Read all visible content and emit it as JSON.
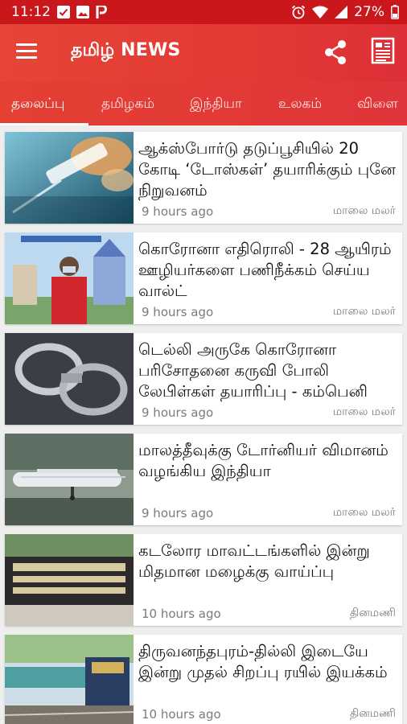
{
  "status_bar": {
    "time": "11:12",
    "battery": "27%"
  },
  "app_bar": {
    "title": "தமிழ் NEWS"
  },
  "tabs": [
    {
      "label": "தலைப்பு"
    },
    {
      "label": "தமிழகம்"
    },
    {
      "label": "இந்தியா"
    },
    {
      "label": "உலகம்"
    },
    {
      "label": "விளை"
    }
  ],
  "articles": [
    {
      "headline": "ஆக்ஸ்போர்டு தடுப்பூசியில் 20 கோடி ‘டோஸ்கள்’ தயாரிக்கும் புனே நிறுவனம்",
      "time": "9 hours ago",
      "source": "மாலை மலர்"
    },
    {
      "headline": "கொரோனா எதிரொலி - 28 ஆயிரம் ஊழியர்களை பணிநீக்கம் செய்ய வால்ட்",
      "time": "9 hours ago",
      "source": "மாலை மலர்"
    },
    {
      "headline": "டெல்லி அருகே கொரோனா பரிசோதனை கருவி போலி லேபிள்கள் தயாரிப்பு - கம்பெனி",
      "time": "9 hours ago",
      "source": "மாலை மலர்"
    },
    {
      "headline": "மாலத்தீவுக்கு டோர்னியர் விமானம் வழங்கிய இந்தியா",
      "time": "9 hours ago",
      "source": "மாலை மலர்"
    },
    {
      "headline": "கடலோர மாவட்டங்களில் இன்று மிதமான மழைக்கு வாய்ப்பு",
      "time": "10 hours ago",
      "source": "தினமணி"
    },
    {
      "headline": "திருவனந்தபுரம்-தில்லி இடையே இன்று முதல் சிறப்பு ரயில் இயக்கம்",
      "time": "10 hours ago",
      "source": "தினமணி"
    }
  ],
  "colors": {
    "status_bar": "#c9171b",
    "app_bar": "#e23a35",
    "background": "#eeeeee"
  },
  "icons": [
    "menu-icon",
    "share-icon",
    "newspaper-icon",
    "check-icon",
    "image-icon",
    "parking-icon",
    "alarm-icon",
    "wifi-icon",
    "signal-icon",
    "battery-icon"
  ]
}
